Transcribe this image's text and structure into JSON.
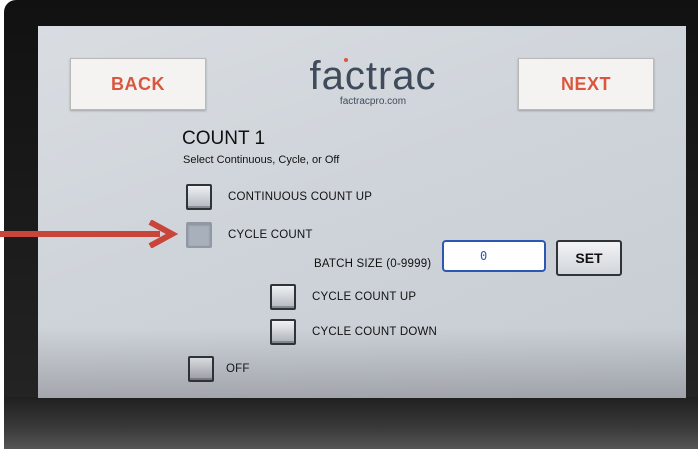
{
  "header": {
    "back_label": "BACK",
    "next_label": "NEXT",
    "logo_text": "factrac",
    "logo_url": "factracpro.com"
  },
  "page": {
    "title": "COUNT 1",
    "subtitle": "Select Continuous, Cycle, or Off"
  },
  "options": {
    "continuous": {
      "label": "CONTINUOUS COUNT UP"
    },
    "cycle": {
      "label": "CYCLE COUNT"
    },
    "batch": {
      "label": "BATCH SIZE (0-9999)",
      "value": "0",
      "set_label": "SET"
    },
    "cycle_up": {
      "label": "CYCLE COUNT UP"
    },
    "cycle_down": {
      "label": "CYCLE COUNT DOWN"
    },
    "off": {
      "label": "OFF"
    }
  },
  "colors": {
    "accent": "#d9573f",
    "input_border": "#2c58b3",
    "arrow": "#c9453a"
  },
  "icons": {
    "annotation_arrow": "arrow-right-icon"
  }
}
